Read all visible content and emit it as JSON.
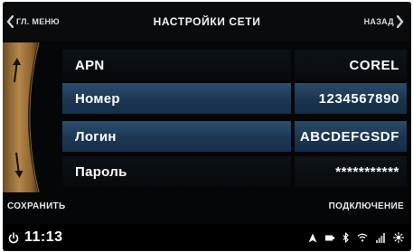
{
  "header": {
    "back_left_label": "ГЛ. МЕНЮ",
    "title": "НАСТРОЙКИ СЕТИ",
    "back_right_label": "НАЗАД"
  },
  "rows": [
    {
      "label": "APN",
      "value": "COREL"
    },
    {
      "label": "Номер",
      "value": "1234567890"
    },
    {
      "label": "Логин",
      "value": "ABCDEFGSDF"
    },
    {
      "label": "Пароль",
      "value": "***********"
    }
  ],
  "actions": {
    "save_label": "СОХРАНИТЬ",
    "connect_label": "ПОДКЛЮЧЕНИЕ"
  },
  "status_bar": {
    "time": "11:13",
    "icons": [
      "power-icon",
      "navigation-arrow-icon",
      "battery-icon",
      "bluetooth-icon",
      "wifi-icon",
      "signal-icon",
      "brightness-icon"
    ]
  },
  "colors": {
    "background": "#050607",
    "row_highlight": "#1c3754",
    "scroll_strip": "#a77a3f",
    "text": "#ffffff"
  }
}
